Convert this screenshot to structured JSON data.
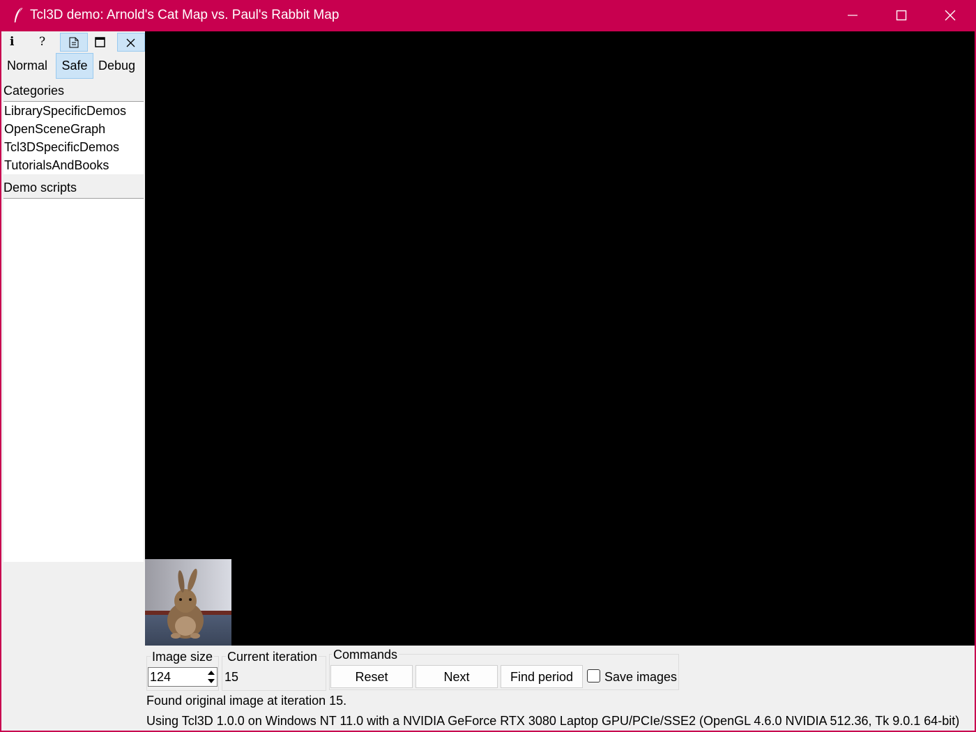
{
  "window": {
    "title": "Tcl3D demo: Arnold's Cat Map vs. Paul's Rabbit Map",
    "accent": "#c8004f"
  },
  "toolbar": {
    "buttons": [
      {
        "name": "info-icon",
        "label": "i",
        "active": false
      },
      {
        "name": "help-icon",
        "label": "?",
        "active": false
      },
      {
        "name": "document-icon",
        "active": true
      },
      {
        "name": "maximize-icon",
        "active": false
      },
      {
        "name": "close-icon",
        "active": true
      }
    ]
  },
  "modes": {
    "normal": "Normal",
    "safe": "Safe",
    "debug": "Debug",
    "selected": "Safe"
  },
  "categories": {
    "label": "Categories",
    "items": [
      "LibrarySpecificDemos",
      "OpenSceneGraph",
      "Tcl3DSpecificDemos",
      "TutorialsAndBooks"
    ]
  },
  "demo_scripts": {
    "label": "Demo scripts",
    "items": []
  },
  "controls": {
    "image_size": {
      "label": "Image size",
      "value": "124"
    },
    "current_iteration": {
      "label": "Current iteration",
      "value": "15"
    },
    "commands": {
      "label": "Commands",
      "reset": "Reset",
      "next": "Next",
      "find_period": "Find period",
      "save_images": "Save images",
      "save_images_checked": false
    }
  },
  "status": {
    "message": "Found original image at iteration 15.",
    "info": "Using Tcl3D 1.0.0 on Windows NT 11.0 with a NVIDIA GeForce RTX 3080 Laptop GPU/PCIe/SSE2 (OpenGL 4.6.0 NVIDIA 512.36, Tk 9.0.1 64-bit)"
  }
}
